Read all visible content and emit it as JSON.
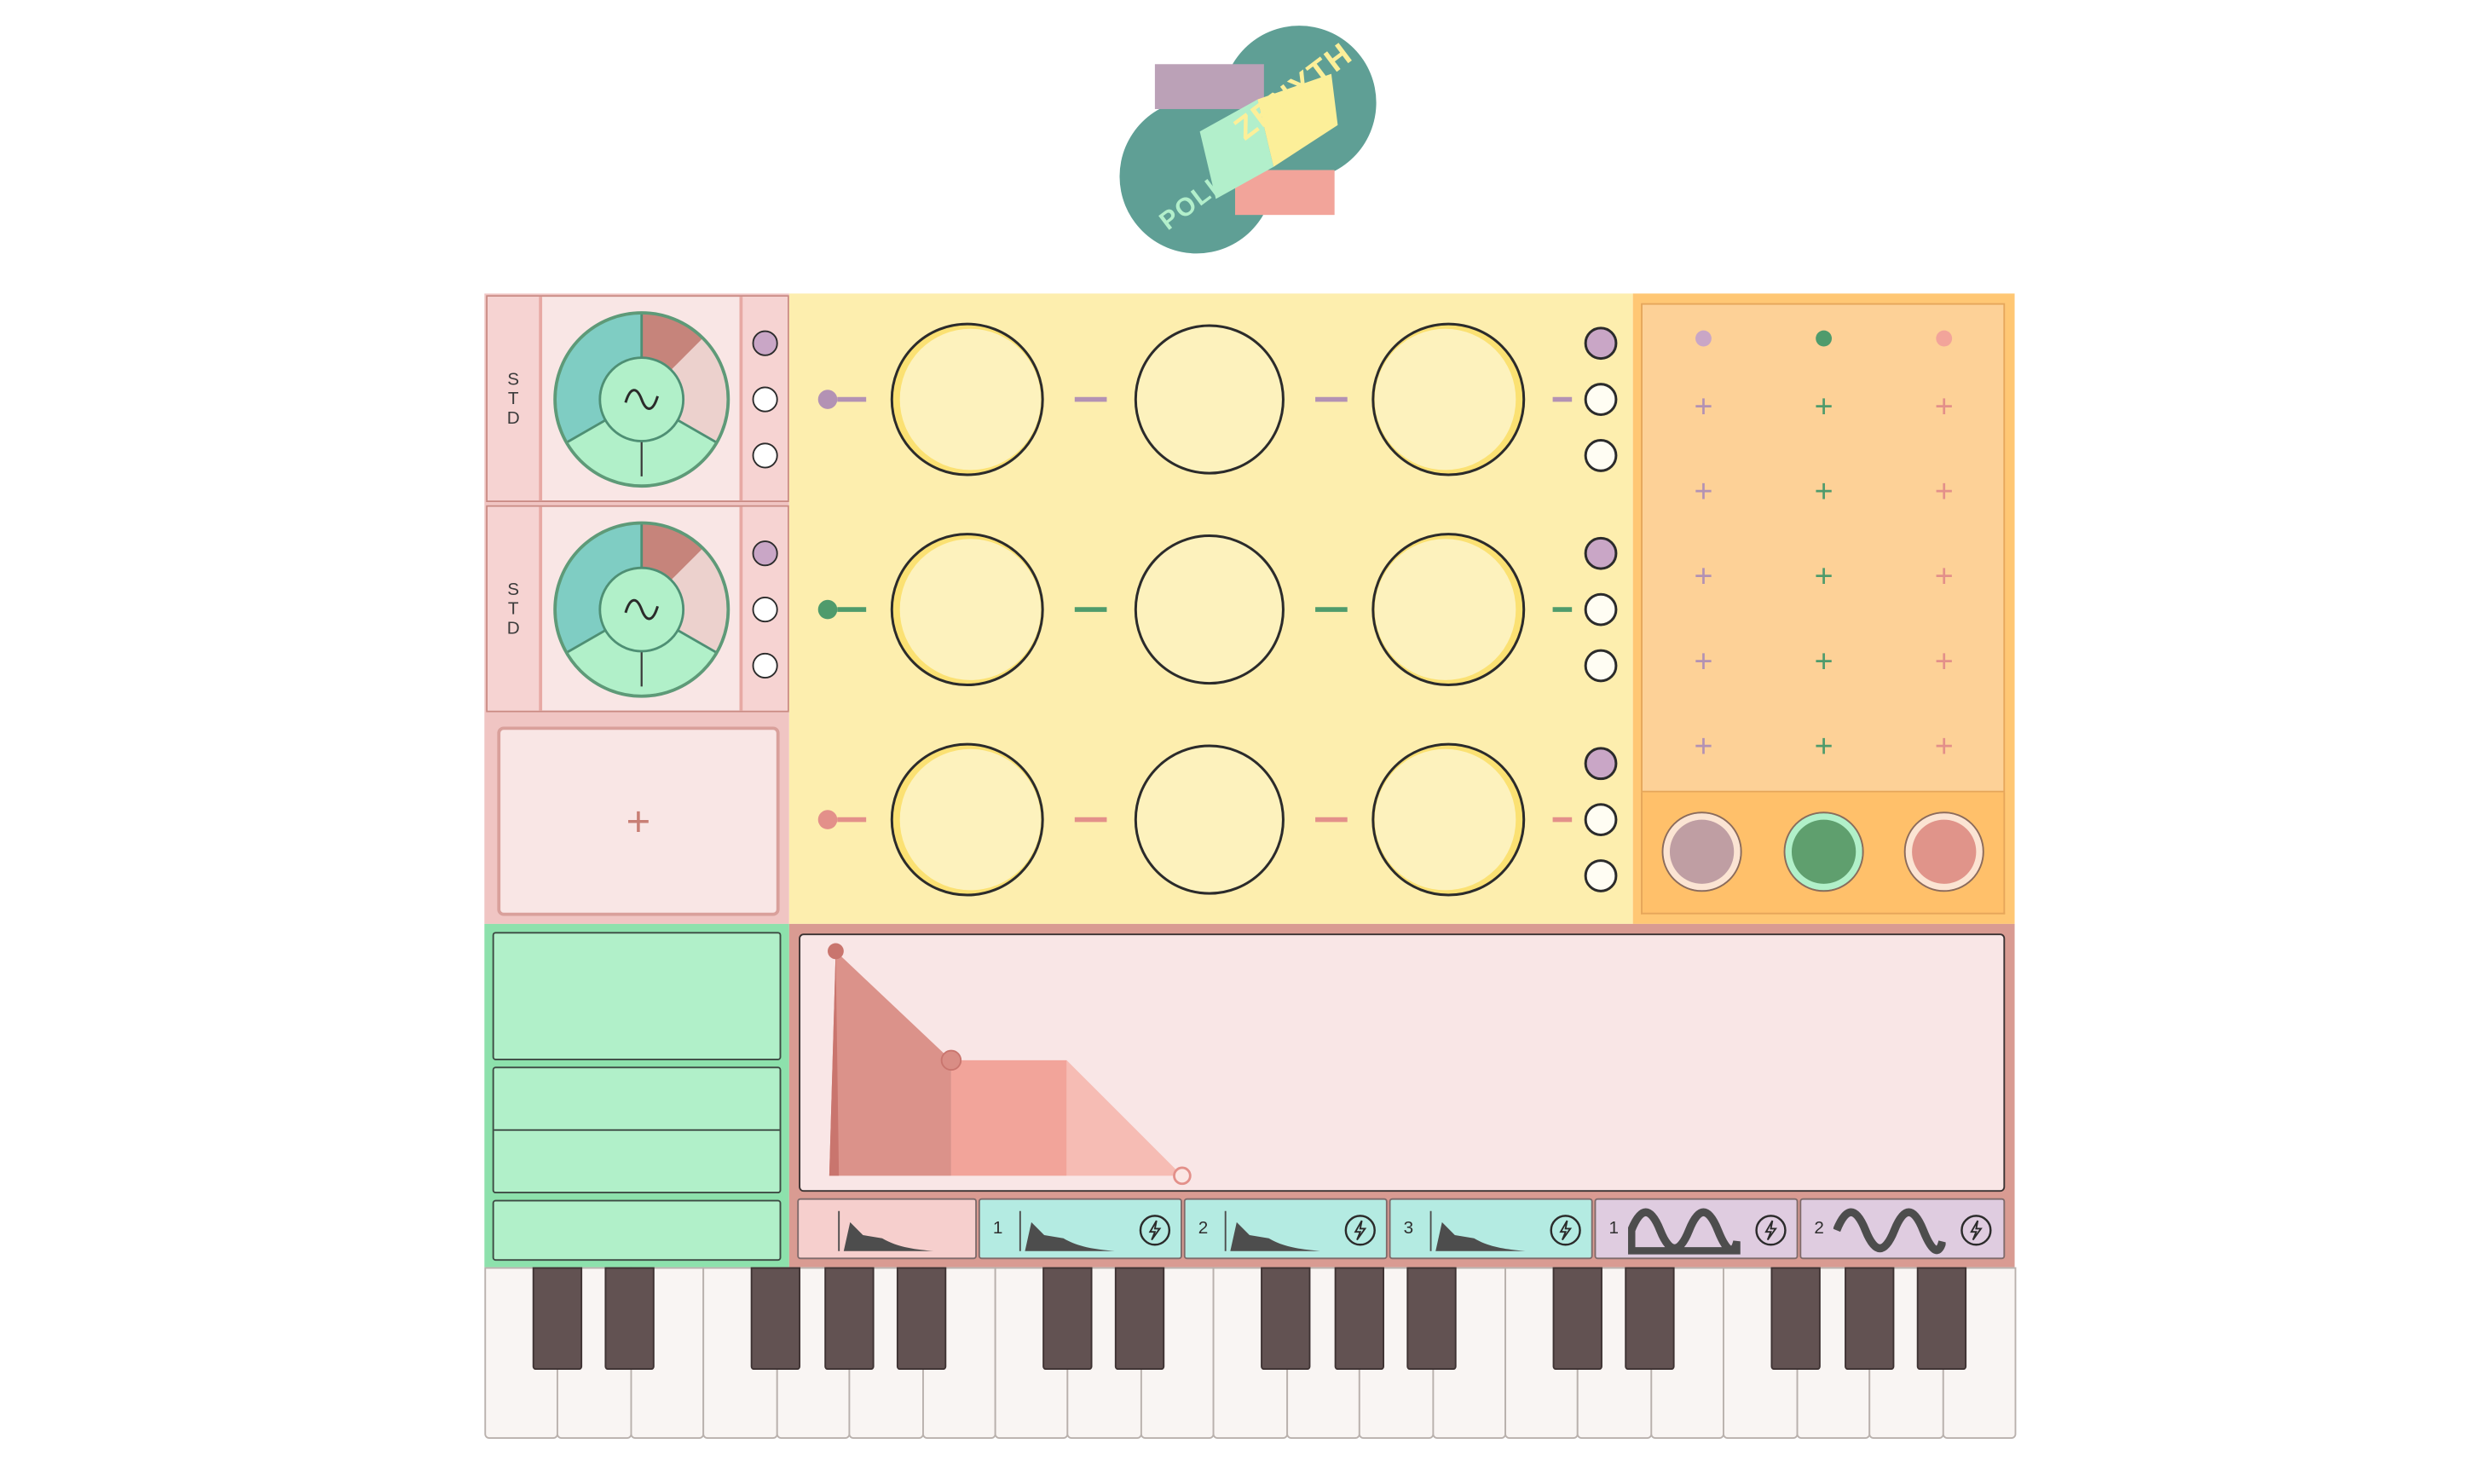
{
  "logo": {
    "word1": "POLISINT",
    "word2": "ZENYTH"
  },
  "oscillators": [
    {
      "label": "STD",
      "waveform_icon": "sine-wave-icon"
    },
    {
      "label": "STD",
      "waveform_icon": "sine-wave-icon"
    }
  ],
  "add_oscillator": {
    "label": "+"
  },
  "operator_rows": 3,
  "operators_per_row": 3,
  "row_colors": [
    "#b392b4",
    "#4f9b6c",
    "#e3908a"
  ],
  "matrix": {
    "plus_rows": 5,
    "plus_symbol": "+",
    "columns": 3
  },
  "envelope": {
    "attack": 0.01,
    "decay": 0.12,
    "sustain": 0.5,
    "release": 0.2
  },
  "tabs": [
    {
      "num": "",
      "icon": "envelope-icon",
      "color": "#f6cfcd"
    },
    {
      "num": "1",
      "icon": "envelope-icon",
      "color": "#b4ebe2"
    },
    {
      "num": "2",
      "icon": "envelope-icon",
      "color": "#b4ebe2"
    },
    {
      "num": "3",
      "icon": "envelope-icon",
      "color": "#b4ebe2"
    },
    {
      "num": "1",
      "icon": "lfo-wave-icon",
      "color": "#dfcce0"
    },
    {
      "num": "2",
      "icon": "lfo-wave-icon",
      "color": "#dfcce0"
    }
  ],
  "colors": {
    "yellow": "#fdeeae",
    "orange": "#ffc774",
    "green": "#8de1ac",
    "pink": "#f9e6e5",
    "teal": "#7fcdc3",
    "envelope": "#d99b92"
  }
}
